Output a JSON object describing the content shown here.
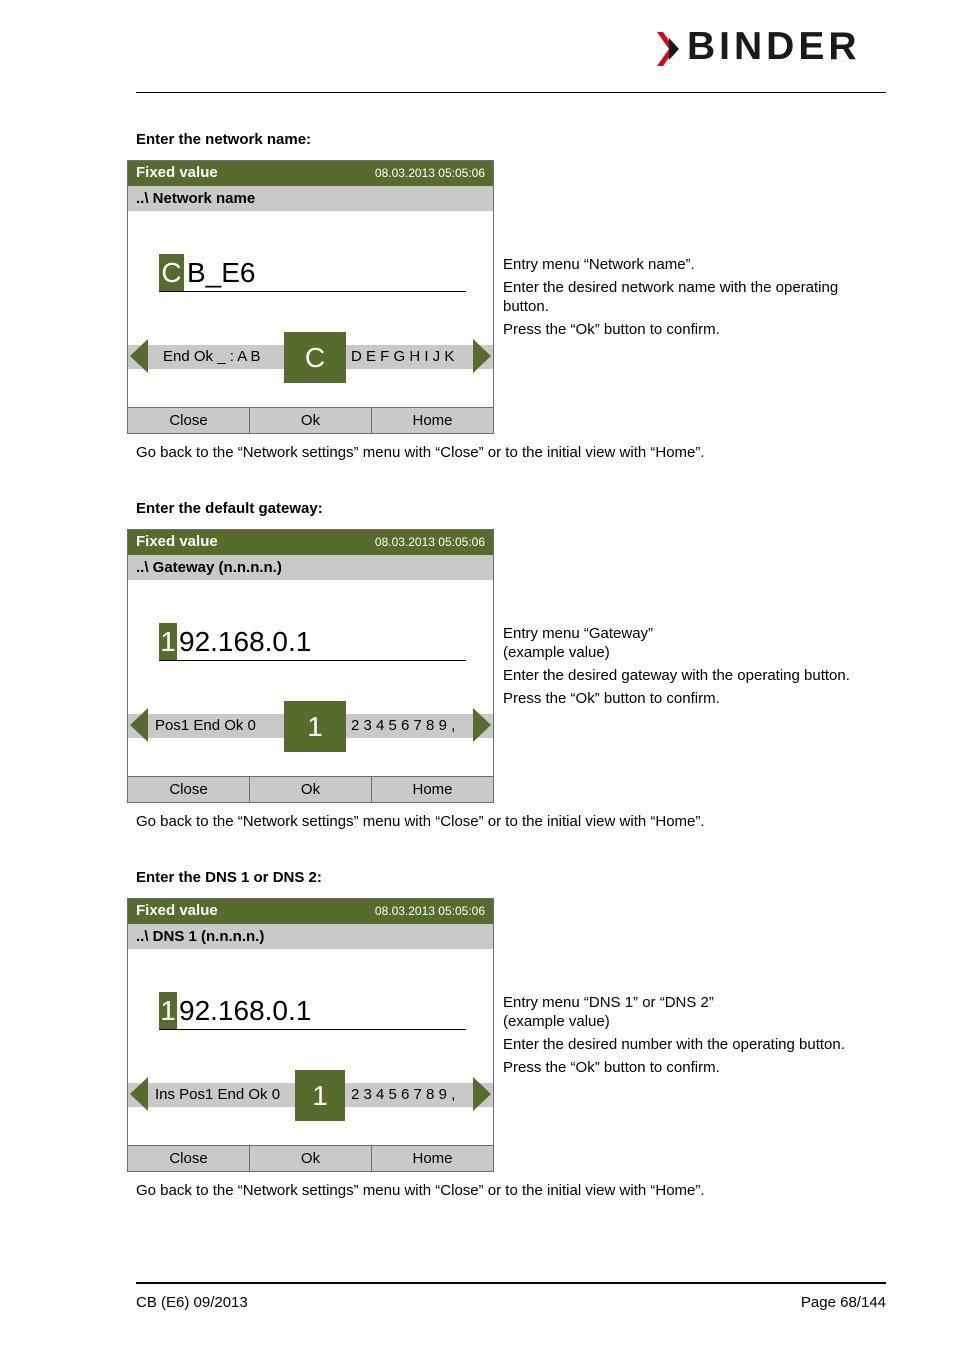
{
  "logo": {
    "text": "BINDER",
    "accent": "#e2001a"
  },
  "sections": [
    {
      "heading": "Enter the network name:",
      "screen": {
        "title": "Fixed value",
        "datetime": "08.03.2013  05:05:06",
        "path": "..\\ Network name",
        "cursor_char": "C",
        "value_rest": "B_E6",
        "left_chars": "End Ok _ : A B",
        "selected_char": "C",
        "right_chars": "D E F G H I J K",
        "buttons": [
          "Close",
          "Ok",
          "Home"
        ]
      },
      "description": [
        "Entry menu “Network name”.",
        "Enter the desired network name with the operating button.",
        "Press the “Ok” button to confirm."
      ],
      "note": "Go back to the “Network settings” menu with “Close” or to the initial view with “Home”."
    },
    {
      "heading": "Enter the default gateway:",
      "screen": {
        "title": "Fixed value",
        "datetime": "08.03.2013  05:05:06",
        "path": "..\\ Gateway (n.n.n.n.)",
        "cursor_char": "1",
        "value_rest": "92.168.0.1",
        "left_chars": "Pos1  End  Ok  0",
        "selected_char": "1",
        "right_chars": "2 3 4 5 6 7 8 9 ,",
        "buttons": [
          "Close",
          "Ok",
          "Home"
        ]
      },
      "description": [
        "Entry menu “Gateway”\n(example value)",
        "Enter the desired gateway with the operating button.",
        "Press the “Ok” button to confirm."
      ],
      "note": "Go back to the “Network settings” menu with “Close” or to the initial view with “Home”."
    },
    {
      "heading": "Enter the DNS 1 or DNS 2:",
      "screen": {
        "title": "Fixed value",
        "datetime": "08.03.2013  05:05:06",
        "path": "..\\ DNS 1 (n.n.n.n.)",
        "cursor_char": "1",
        "value_rest": "92.168.0.1",
        "left_chars": "Ins Pos1 End Ok 0",
        "selected_char": "1",
        "right_chars": "2 3 4 5 6 7 8 9 ,",
        "buttons": [
          "Close",
          "Ok",
          "Home"
        ]
      },
      "description": [
        "Entry menu “DNS 1” or “DNS 2”\n(example value)",
        "Enter the desired number with the operating button.",
        "Press the “Ok” button to confirm."
      ],
      "note": "Go back to the “Network settings” menu with “Close” or to the initial view with “Home”."
    }
  ],
  "footer": {
    "left": "CB (E6) 09/2013",
    "right": "Page 68/144"
  }
}
